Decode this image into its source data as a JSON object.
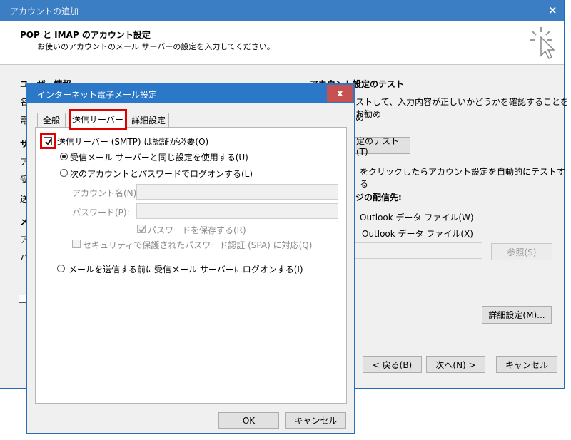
{
  "background_window": {
    "title": "アカウントの追加",
    "close": "×",
    "header_title": "POP と IMAP のアカウント設定",
    "header_subtitle": "お使いのアカウントのメール サーバーの設定を入力してください。",
    "left_section_title": "ユーザー情報",
    "left_fragments": [
      "名",
      "電",
      "サ",
      "ア",
      "受",
      "送",
      "メ",
      "ア",
      "パ"
    ],
    "test_section_title": "アカウント設定のテスト",
    "test_desc_line1": "ストして、入力内容が正しいかどうかを確認することをお勧め",
    "test_desc_line2": "め",
    "test_button": "定のテスト(T)",
    "auto_test_text": "をクリックしたらアカウント設定を自動的にテストする",
    "delivery_label": "ジの配信先:",
    "outlook_option1": "Outlook データ ファイル(W)",
    "outlook_option2": "Outlook データ ファイル(X)",
    "browse_button": "参照(S)",
    "advanced_button": "詳細設定(M)...",
    "back_button": "< 戻る(B)",
    "next_button": "次へ(N) >",
    "cancel_button": "キャンセル"
  },
  "dialog": {
    "title": "インターネット電子メール設定",
    "close": "x",
    "tabs": [
      {
        "label": "全般",
        "active": false
      },
      {
        "label": "送信サーバー",
        "active": true
      },
      {
        "label": "詳細設定",
        "active": false
      }
    ],
    "smtp_auth_checkbox": {
      "label": "送信サーバー (SMTP) は認証が必要(O)",
      "checked": true
    },
    "radio_same_settings": {
      "label": "受信メール サーバーと同じ設定を使用する(U)",
      "selected": true
    },
    "radio_login_with": {
      "label": "次のアカウントとパスワードでログオンする(L)",
      "selected": false
    },
    "account_name_label": "アカウント名(N):",
    "account_name_value": "",
    "password_label": "パスワード(P):",
    "password_value": "",
    "save_password": {
      "label": "パスワードを保存する(R)",
      "checked": true
    },
    "spa": {
      "label": "セキュリティで保護されたパスワード認証 (SPA) に対応(Q)",
      "checked": false
    },
    "radio_login_before_send": {
      "label": "メールを送信する前に受信メール サーバーにログオンする(I)",
      "selected": false
    },
    "ok_button": "OK",
    "cancel_button": "キャンセル"
  },
  "colors": {
    "title_bar": "#3b7ec4",
    "dialog_title_bar": "#2b78c8",
    "close_red": "#c75050",
    "highlight": "#e00000"
  }
}
